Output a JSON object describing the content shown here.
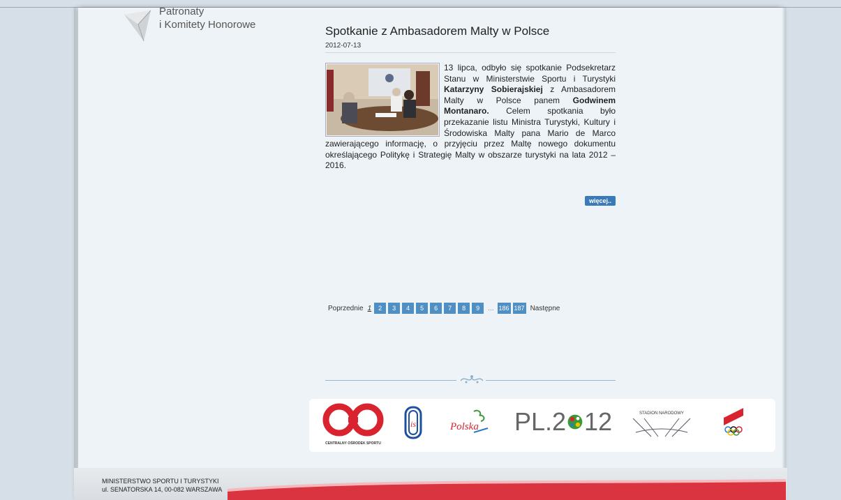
{
  "sidebar": {
    "patronaty_line1": "Patronaty",
    "patronaty_line2": "i Komitety Honorowe"
  },
  "article": {
    "title": "Spotkanie z Ambasadorem Malty w Polsce",
    "date": "2012-07-13",
    "body_intro": "13 lipca, odbyło się spotkanie Podsekretarz Stanu w Ministerstwie Sportu i Turystyki ",
    "body_name1": "Katarzyny Sobierajskiej",
    "body_mid": " z Ambasadorem Malty w Polsce panem ",
    "body_name2": "Godwinem Montanaro.",
    "body_rest": " Celem spotkania było przekazanie listu Ministra Turystyki, Kultury i Środowiska Malty pana Mario de Marco zawierającego informację, o przyjęciu przez Maltę nowego dokumentu określającego Politykę i Strategię Malty w obszarze turystyki na lata 2012 – 2016.",
    "more_label": "więcej.."
  },
  "pagination": {
    "prev_label": "Poprzednie",
    "current": "1",
    "pages": [
      "2",
      "3",
      "4",
      "5",
      "6",
      "7",
      "8",
      "9"
    ],
    "ellipsis": "...",
    "last_pages": [
      "186",
      "187"
    ],
    "next_label": "Następne"
  },
  "logos": {
    "cos_caption": "CENTRALNY OŚRODEK SPORTU",
    "polska_text": "Polska",
    "pl2012_text_a": "PL.2",
    "pl2012_text_b": "12",
    "stadion_text": "STADION NARODOWY"
  },
  "footer": {
    "line1": "MINISTERSTWO SPORTU I TURYSTYKI",
    "line2": "ul. SENATORSKA 14, 00-082 WARSZAWA"
  },
  "colors": {
    "accent": "#4f8fc4",
    "more_button": "#3a7ab8",
    "page_bg": "#eef3f7",
    "outer_bg": "#d6dfe7",
    "footer_red": "#d9343f"
  }
}
